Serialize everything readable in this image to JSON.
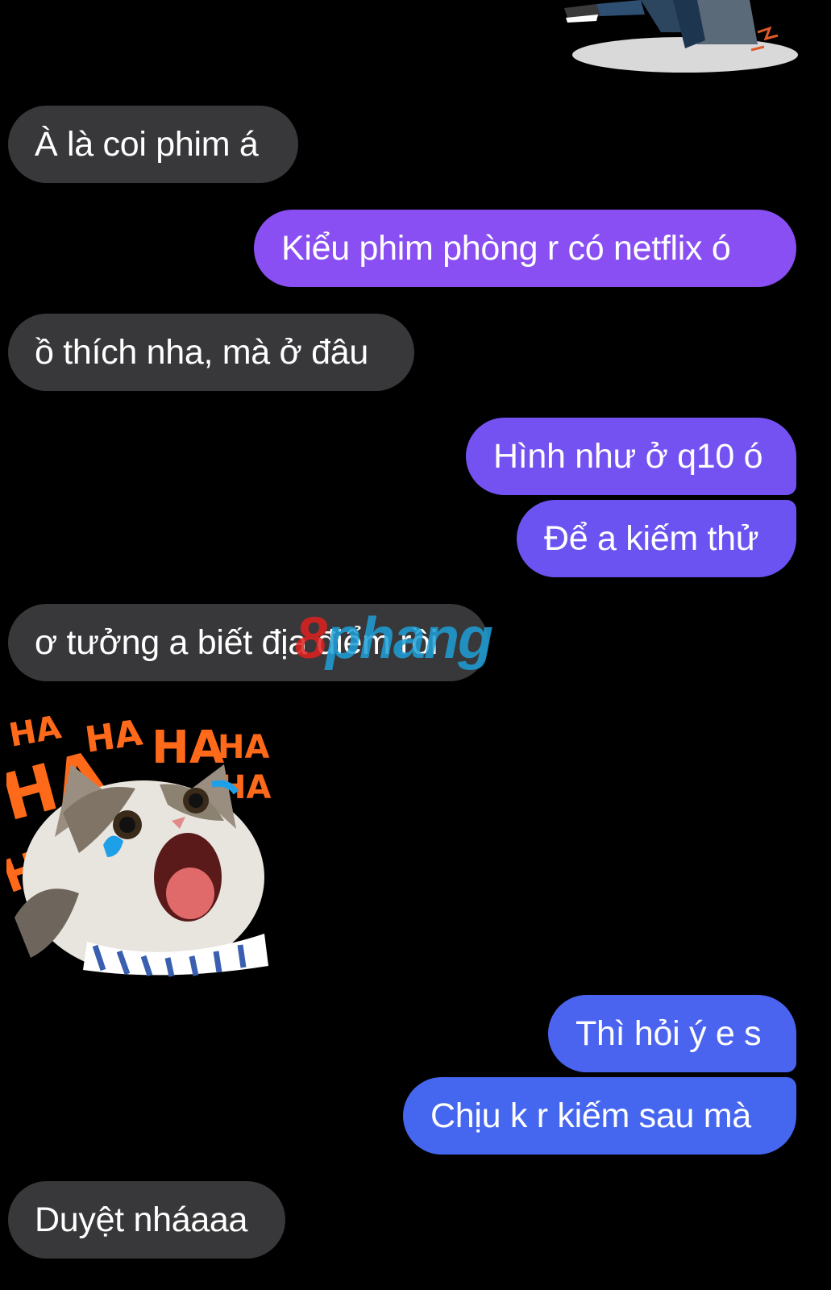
{
  "chat": {
    "messages": [
      {
        "side": "incoming",
        "text": "À là coi phim á"
      },
      {
        "side": "outgoing",
        "text": "Kiểu phim phòng r có netflix ó",
        "color": "#8a4ff2"
      },
      {
        "side": "incoming",
        "text": "ồ thích nha, mà ở đâu"
      },
      {
        "side": "outgoing",
        "text": "Hình như ở q10 ó",
        "color": "#7451f1"
      },
      {
        "side": "outgoing",
        "text": "Để a kiếm thử",
        "color": "#6a53f0"
      },
      {
        "side": "incoming",
        "text": "ơ tưởng a biết địa điểm rồi"
      },
      {
        "side": "outgoing",
        "text": "Thì hỏi ý e s",
        "color": "#4a64f0"
      },
      {
        "side": "outgoing",
        "text": "Chịu k r kiếm sau mà",
        "color": "#4566ef"
      },
      {
        "side": "incoming",
        "text": "Duyệt nháaaa"
      }
    ],
    "stickers": [
      {
        "name": "cartoon-boy-sticker"
      },
      {
        "name": "laughing-cat-sticker",
        "caption_words": [
          "HA",
          "HA",
          "HA",
          "HA",
          "HA",
          "HA",
          "HA"
        ]
      }
    ]
  },
  "watermark": {
    "first": "8",
    "rest": "phang"
  },
  "colors": {
    "background": "#000000",
    "incoming_bubble": "#38383a",
    "text": "#ffffff"
  }
}
